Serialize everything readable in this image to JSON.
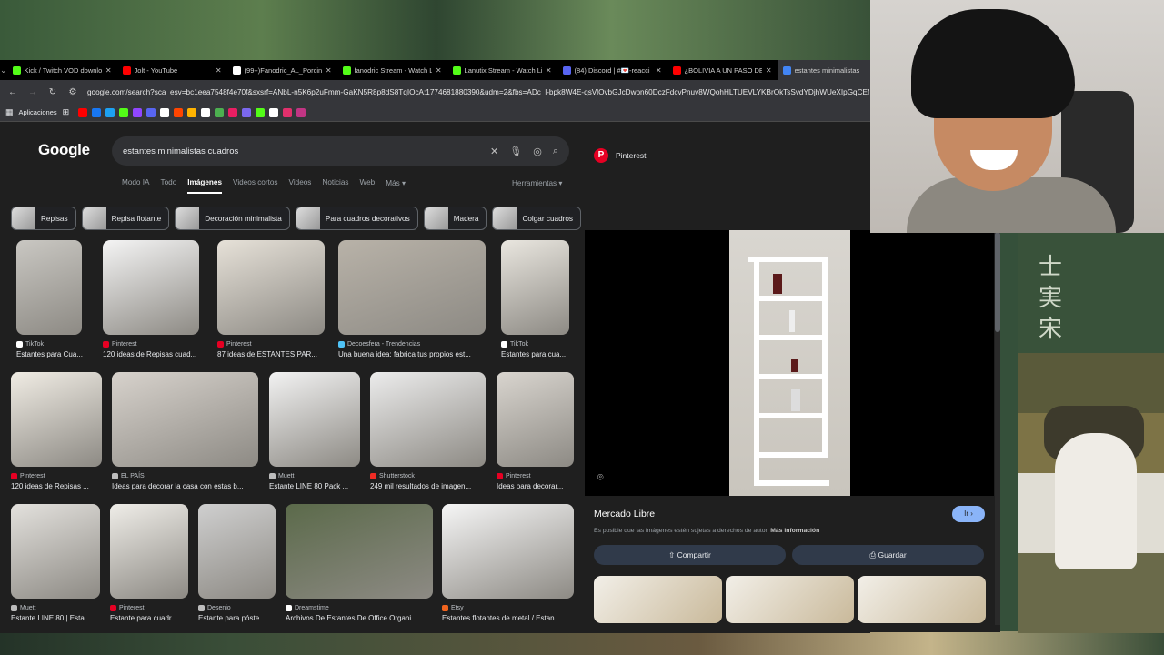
{
  "browser": {
    "tabs": [
      {
        "title": "Kick / Twitch VOD downlo",
        "favicon_color": "#53fc18"
      },
      {
        "title": "Jolt - YouTube",
        "favicon_color": "#ff0000"
      },
      {
        "title": "(99+)Fanodric_AL_Porcina",
        "favicon_color": "#ffffff"
      },
      {
        "title": "fanodric Stream - Watch L",
        "favicon_color": "#53fc18"
      },
      {
        "title": "Lanutix Stream - Watch Li",
        "favicon_color": "#53fc18"
      },
      {
        "title": "(84) Discord | #💌-reacci",
        "favicon_color": "#5865f2"
      },
      {
        "title": "¿BOLIVIA A UN PASO DE",
        "favicon_color": "#ff0000"
      },
      {
        "title": "estantes minimalistas",
        "favicon_color": "#4285f4",
        "active": true
      }
    ],
    "url": "google.com/search?sca_esv=bc1eea7548f4e70f&sxsrf=ANbL-n5K6p2uFmm-GaKN5R8p8dS8TqIOcA:1774681880390&udm=2&fbs=ADc_l-bpk8W4E-qsVlOvbGJcDwpn60DczFdcvPnuv8WQohHLTUEVLYKBrOkTsSvdYDjhWUeXIpGqCEfMfxoMEP",
    "bookmarks_label": "Aplicaciones",
    "bookmark_colors": [
      "#ff0000",
      "#1877f2",
      "#1da1f2",
      "#53fc18",
      "#9146ff",
      "#5865f2",
      "#ffffff",
      "#ff4500",
      "#ffb300",
      "#ffffff",
      "#4caf50",
      "#e91e63",
      "#7b68ee",
      "#53fc18",
      "#ffffff",
      "#e1306c",
      "#c13584"
    ]
  },
  "google": {
    "logo": "Google",
    "query": "estantes minimalistas cuadros",
    "nav": [
      "Modo IA",
      "Todo",
      "Imágenes",
      "Videos cortos",
      "Videos",
      "Noticias",
      "Web",
      "Más ▾"
    ],
    "active_nav": "Imágenes",
    "tools": "Herramientas ▾",
    "chips": [
      "Repisas",
      "Repisa flotante",
      "Decoración minimalista",
      "Para cuadros decorativos",
      "Madera",
      "Colgar cuadros"
    ]
  },
  "results": [
    {
      "source": "TikTok",
      "caption": "Estantes para Cua...",
      "dot": "#ffffff"
    },
    {
      "source": "Pinterest",
      "caption": "120 ideas de Repisas cuad...",
      "dot": "#e60023"
    },
    {
      "source": "Pinterest",
      "caption": "87 ideas de ESTANTES PAR...",
      "dot": "#e60023"
    },
    {
      "source": "Decoesfera - Trendencias",
      "caption": "Una buena idea: fabrica tus propios est...",
      "dot": "#4fc3f7"
    },
    {
      "source": "TikTok",
      "caption": "Estantes para cua...",
      "dot": "#ffffff"
    },
    {
      "source": "Pinterest",
      "caption": "120 ideas de Repisas ...",
      "dot": "#e60023"
    },
    {
      "source": "EL PAÍS",
      "caption": "Ideas para decorar la casa con estas b...",
      "dot": "#bdbdbd"
    },
    {
      "source": "Muett",
      "caption": "Estante LINE 80 Pack ...",
      "dot": "#bdbdbd"
    },
    {
      "source": "Shutterstock",
      "caption": "249 mil resultados de imagen...",
      "dot": "#ee2b24"
    },
    {
      "source": "Pinterest",
      "caption": "Ideas para decorar...",
      "dot": "#e60023"
    },
    {
      "source": "Muett",
      "caption": "Estante LINE 80 | Esta...",
      "dot": "#bdbdbd"
    },
    {
      "source": "Pinterest",
      "caption": "Estante para cuadr...",
      "dot": "#e60023"
    },
    {
      "source": "Desenio",
      "caption": "Estante para póste...",
      "dot": "#bdbdbd"
    },
    {
      "source": "Dreamstime",
      "caption": "Archivos De Estantes De Office Organi...",
      "dot": "#ffffff"
    },
    {
      "source": "Etsy",
      "caption": "Estantes flotantes de metal / Estan...",
      "dot": "#f1641e"
    }
  ],
  "preview": {
    "source": "Pinterest",
    "title": "Mercado Libre",
    "go": "Ir ›",
    "note": "Es posible que las imágenes estén sujetas a derechos de autor.",
    "note_link": "Más información",
    "share": "⇧ Compartir",
    "save": "⎙ Guardar"
  },
  "stream": {
    "kanji": "士\n実\n宋"
  }
}
